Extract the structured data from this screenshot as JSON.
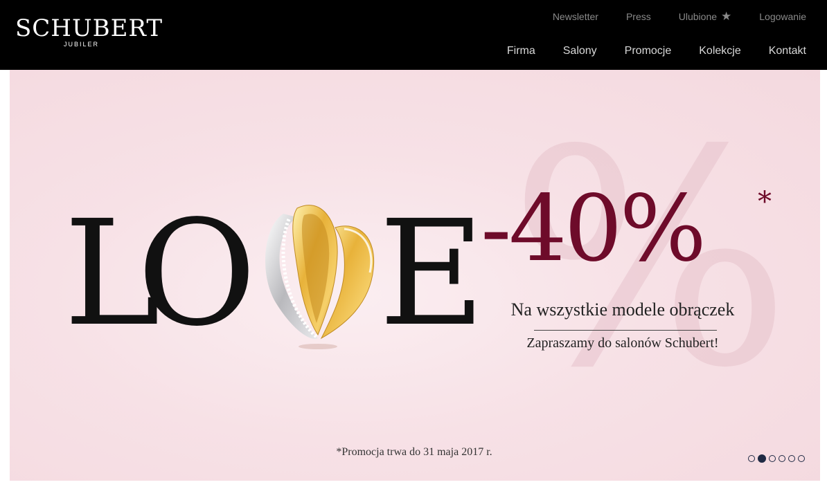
{
  "brand": {
    "name": "SCHUBERT",
    "tagline": "JUBILER"
  },
  "top_nav": {
    "newsletter": "Newsletter",
    "press": "Press",
    "favorites": "Ulubione",
    "favorites_icon": "star-icon",
    "login": "Logowanie"
  },
  "main_nav": [
    {
      "label": "Firma"
    },
    {
      "label": "Salony"
    },
    {
      "label": "Promocje"
    },
    {
      "label": "Kolekcje"
    },
    {
      "label": "Kontakt"
    }
  ],
  "banner": {
    "love_letters": {
      "l": "L",
      "o": "O",
      "e": "E"
    },
    "discount": "-40%",
    "asterisk": "*",
    "subtitle": "Na wszystkie modele obrączek",
    "invite": "Zapraszamy do salonów Schubert!",
    "footnote": "*Promocja trwa do 31 maja 2017 r.",
    "slides_total": 6,
    "active_slide": 2
  },
  "colors": {
    "header_bg": "#000000",
    "banner_bg": "#f7e1e6",
    "accent": "#6e0b2a",
    "dot": "#1f2a44"
  }
}
